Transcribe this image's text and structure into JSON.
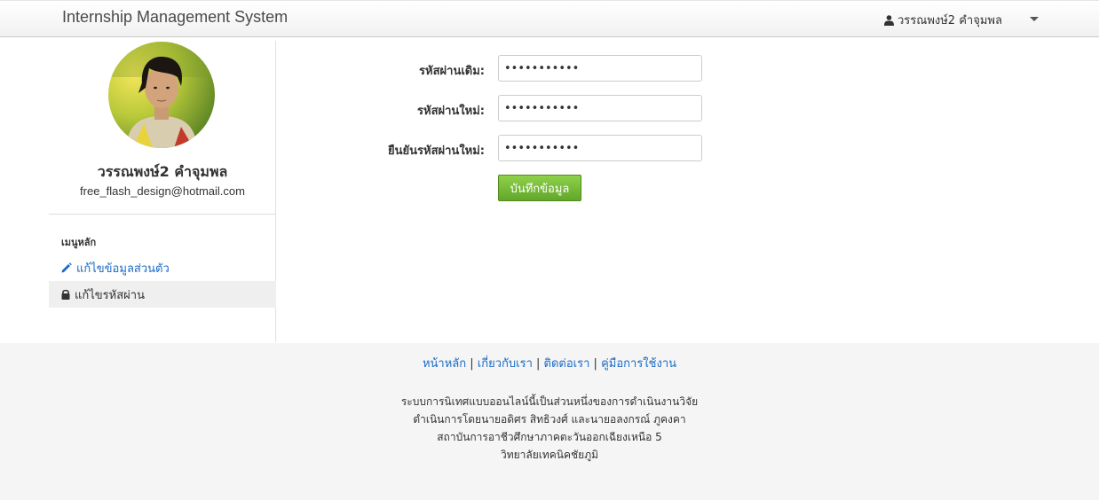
{
  "navbar": {
    "brand": "Internship Management System",
    "user_name": "วรรณพงษ์2 คำจุมพล"
  },
  "profile": {
    "name": "วรรณพงษ์2 คำจุมพล",
    "email": "free_flash_design@hotmail.com"
  },
  "menu": {
    "header": "เมนูหลัก",
    "items": [
      {
        "label": "แก้ไขข้อมูลส่วนตัว",
        "icon": "pencil-icon"
      },
      {
        "label": "แก้ไขรหัสผ่าน",
        "icon": "lock-icon"
      }
    ]
  },
  "form": {
    "old_password_label": "รหัสผ่านเดิม:",
    "old_password_value": "•••••••••••",
    "new_password_label": "รหัสผ่านใหม่:",
    "new_password_value": "•••••••••••",
    "confirm_password_label": "ยืนยันรหัสผ่านใหม่:",
    "confirm_password_value": "•••••••••••",
    "save_label": "บันทึกข้อมูล"
  },
  "footer": {
    "links": [
      "หน้าหลัก",
      "เกี่ยวกับเรา",
      "ติดต่อเรา",
      "คู่มือการใช้งาน"
    ],
    "separator": " | ",
    "lines": [
      "ระบบการนิเทศแบบออนไลน์นี้เป็นส่วนหนึ่งของการดำเนินงานวิจัย",
      "ดำเนินการโดยนายอดิศร สิทธิวงศ์ และนายอลงกรณ์ ภูคงคา",
      "สถาบันการอาชีวศึกษาภาคตะวันออกเฉียงเหนือ 5",
      "วิทยาลัยเทคนิคชัยภูมิ"
    ]
  },
  "colors": {
    "link": "#1a6bc7",
    "save_button": "#6fb534",
    "footer_bg": "#f5f5f5"
  }
}
